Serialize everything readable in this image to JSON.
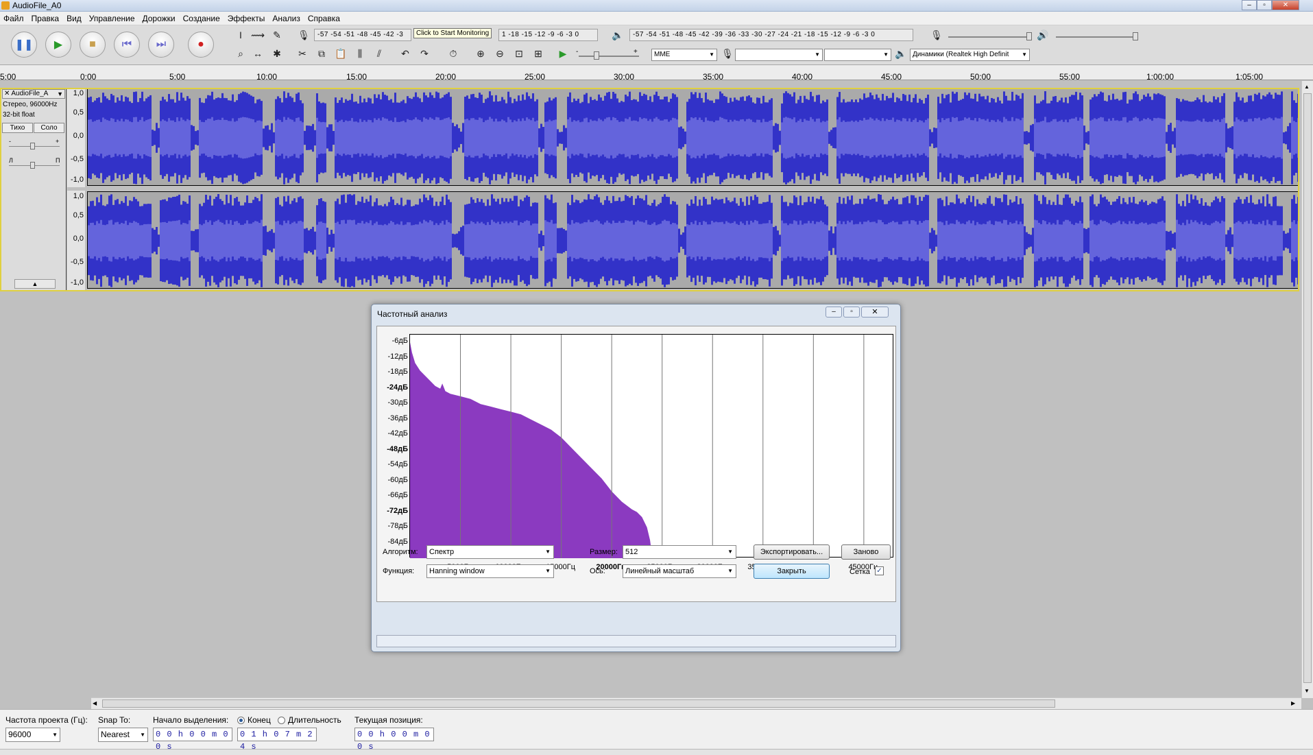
{
  "window": {
    "title": "AudioFile_A0"
  },
  "menu": [
    "Файл",
    "Правка",
    "Вид",
    "Управление",
    "Дорожки",
    "Создание",
    "Эффекты",
    "Анализ",
    "Справка"
  ],
  "toolbar": {
    "rec_meter": "-57 -54 -51 -48 -45 -42 -3",
    "monitor_hint": "Click to Start Monitoring",
    "rec_meter_tail": "1 -18 -15 -12 -9 -6 -3 0",
    "play_meter": "-57 -54 -51 -48 -45 -42 -39 -36 -33 -30 -27 -24 -21 -18 -15 -12 -9 -6 -3 0",
    "host": "MME",
    "output_device": "Динамики (Realtek High Definit",
    "rec_meter_lr": "Л\nП",
    "play_slider_minus": "-",
    "play_slider_plus": "+"
  },
  "ruler": {
    "labels": [
      "5:00",
      "0:00",
      "5:00",
      "10:00",
      "15:00",
      "20:00",
      "25:00",
      "30:00",
      "35:00",
      "40:00",
      "45:00",
      "50:00",
      "55:00",
      "1:00:00",
      "1:05:00"
    ]
  },
  "track": {
    "name": "AudioFile_A",
    "info1": "Стерео, 96000Hz",
    "info2": "32-bit float",
    "mute": "Тихо",
    "solo": "Соло",
    "gain_minus": "-",
    "gain_plus": "+",
    "pan_left": "Л",
    "pan_right": "П",
    "scale": [
      "1,0",
      "0,5",
      "0,0",
      "-0,5",
      "-1,0"
    ]
  },
  "dialog": {
    "title": "Частотный анализ",
    "algorithm_label": "Алгоритм:",
    "algorithm_value": "Спектр",
    "size_label": "Размер:",
    "size_value": "512",
    "export_button": "Экспортировать...",
    "replot_button": "Заново",
    "function_label": "Функция:",
    "function_value": "Hanning window",
    "axis_label": "Ось:",
    "axis_value": "Линейный масштаб",
    "close_button": "Закрыть",
    "grid_label": "Сетка",
    "grid_checked": true
  },
  "chart_data": {
    "type": "area",
    "xlabel": "",
    "ylabel": "",
    "x_unit": "Гц",
    "y_unit": "дБ",
    "xlim": [
      0,
      48000
    ],
    "ylim": [
      -90,
      -3
    ],
    "grid": true,
    "y_ticks": [
      "-6дБ",
      "-12дБ",
      "-18дБ",
      "-24дБ",
      "-30дБ",
      "-36дБ",
      "-42дБ",
      "-48дБ",
      "-54дБ",
      "-60дБ",
      "-66дБ",
      "-72дБ",
      "-78дБ",
      "-84дБ"
    ],
    "y_ticks_bold": [
      "-24дБ",
      "-48дБ",
      "-72дБ"
    ],
    "x_ticks": [
      "5000Гц",
      "10000Гц",
      "15000Гц",
      "20000Гц",
      "25000Гц",
      "30000Гц",
      "35000Гц",
      "40000Гц",
      "45000Гц"
    ],
    "x_ticks_bold": [
      "10000Гц",
      "20000Гц",
      "30000Гц",
      "40000Гц"
    ],
    "series": [
      {
        "color": "#8b3ac0",
        "x": [
          0,
          200,
          500,
          1000,
          1500,
          2000,
          2500,
          3000,
          3200,
          3500,
          4000,
          5000,
          6000,
          7000,
          8000,
          9000,
          10000,
          11000,
          12000,
          13000,
          14000,
          15000,
          16000,
          17000,
          18000,
          19000,
          20000,
          21000,
          22000,
          22500,
          23000,
          23500,
          23800,
          24000
        ],
        "y": [
          -6,
          -10,
          -14,
          -17,
          -19,
          -21,
          -23,
          -24,
          -22,
          -25,
          -26,
          -27,
          -28,
          -30,
          -31,
          -32,
          -33,
          -34,
          -36,
          -38,
          -40,
          -43,
          -47,
          -51,
          -55,
          -59,
          -64,
          -68,
          -71,
          -72,
          -74,
          -78,
          -83,
          -89
        ]
      }
    ]
  },
  "bottom": {
    "rate_label": "Частота проекта (Гц):",
    "rate_value": "96000",
    "snap_label": "Snap To:",
    "snap_value": "Nearest",
    "sel_start_label": "Начало выделения:",
    "end_label": "Конец",
    "length_label": "Длительность",
    "pos_label": "Текущая позиция:",
    "sel_start": "0 0 h 0 0 m 0 0 s",
    "sel_end": "0 1 h 0 7 m 2 4 s",
    "position": "0 0 h 0 0 m 0 0 s"
  }
}
